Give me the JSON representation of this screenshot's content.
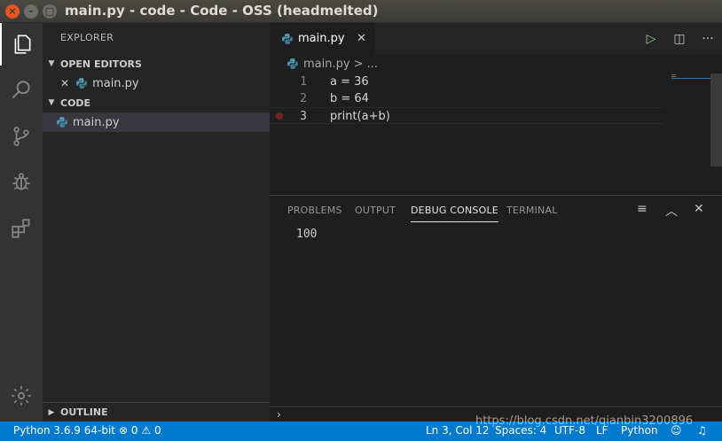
{
  "window": {
    "title": "main.py - code - Code - OSS (headmelted)",
    "close_glyph": "×",
    "min_glyph": "–",
    "max_glyph": "□"
  },
  "activity": {
    "icons": [
      "files-icon",
      "search-icon",
      "source-control-icon",
      "debug-icon",
      "extensions-icon",
      "settings-gear-icon"
    ]
  },
  "sidebar": {
    "title": "EXPLORER",
    "open_editors_label": "OPEN EDITORS",
    "open_editors": [
      {
        "name": "main.py"
      }
    ],
    "folder_label": "CODE",
    "files": [
      {
        "name": "main.py"
      }
    ],
    "outline_label": "OUTLINE"
  },
  "editor": {
    "tab": {
      "label": "main.py"
    },
    "breadcrumb": {
      "file": "main.py",
      "sep": ">",
      "more": "..."
    },
    "lines": [
      {
        "num": "1",
        "code": "a = 36"
      },
      {
        "num": "2",
        "code": "b = 64"
      },
      {
        "num": "3",
        "code": "print(a+b)"
      }
    ],
    "breakpoint_line": 3
  },
  "panel": {
    "tabs": [
      "PROBLEMS",
      "OUTPUT",
      "DEBUG CONSOLE",
      "TERMINAL"
    ],
    "active_tab": "DEBUG CONSOLE",
    "output": "100",
    "prompt": "›"
  },
  "statusbar": {
    "interpreter": "Python 3.6.9 64-bit",
    "errors": "0",
    "warnings": "0",
    "position": "Ln 3, Col 12",
    "spaces": "Spaces: 4",
    "encoding": "UTF-8",
    "eol": "LF",
    "language": "Python"
  },
  "watermark": "https://blog.csdn.net/qianbin3200896",
  "colors": {
    "accent": "#007acc",
    "breakpoint": "#7a1e1e",
    "close_button": "#e95420"
  }
}
